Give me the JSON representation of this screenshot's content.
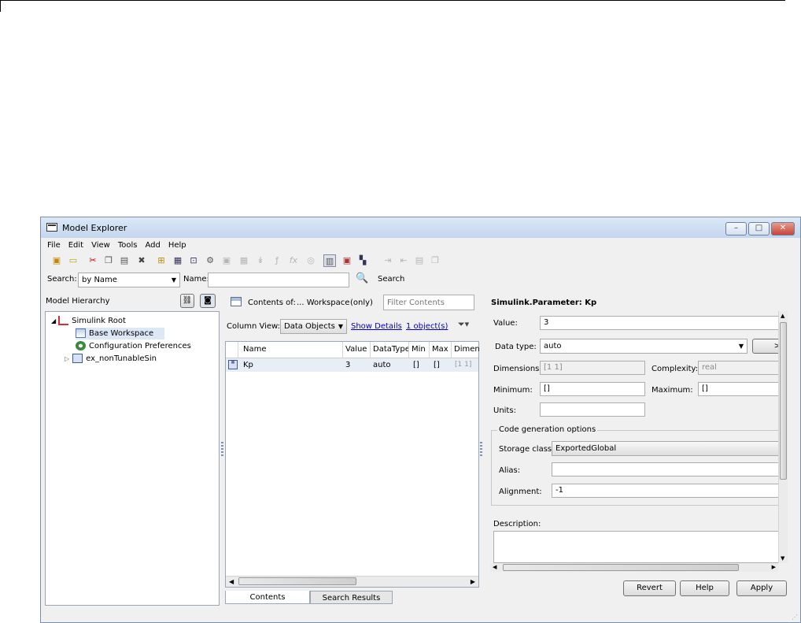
{
  "window": {
    "title": "Model Explorer",
    "controls": {
      "minimize": "–",
      "maximize": "□",
      "close": "✕"
    }
  },
  "menu": [
    "File",
    "Edit",
    "View",
    "Tools",
    "Add",
    "Help"
  ],
  "toolbar_icons": [
    "new-model-icon",
    "open-folder-icon",
    "cut-icon",
    "copy-icon",
    "paste-icon",
    "delete-icon",
    "add-variable-icon",
    "add-parameter-icon",
    "add-signal-icon",
    "add-config-icon",
    "add-bus-icon",
    "add-data-icon",
    "add-port-icon",
    "add-event-icon",
    "add-function-icon",
    "add-message-icon",
    "contents-view-icon",
    "dialog-view-icon",
    "hierarchy-view-icon",
    "export-icon",
    "import-icon",
    "save-icon",
    "clone-icon"
  ],
  "search": {
    "label": "Search:",
    "mode": "by Name",
    "name_label": "Name:",
    "name_value": "",
    "button": "Search"
  },
  "hierarchy": {
    "title": "Model Hierarchy",
    "items": [
      {
        "label": "Simulink Root",
        "expander": "◢"
      },
      {
        "label": "Base Workspace"
      },
      {
        "label": "Configuration Preferences"
      },
      {
        "label": "ex_nonTunableSin",
        "expander": "▷"
      }
    ]
  },
  "contents": {
    "prefix": "Contents of:",
    "scope": "... Workspace",
    "only": "(only)",
    "filter_placeholder": "Filter Contents",
    "column_view_label": "Column View:",
    "column_view": "Data Objects",
    "show_details": "Show Details",
    "object_count": "1 object(s)",
    "columns": [
      "Name",
      "Value",
      "DataType",
      "Min",
      "Max",
      "Dimen"
    ],
    "rows": [
      {
        "name": "Kp",
        "value": "3",
        "datatype": "auto",
        "min": "[]",
        "max": "[]",
        "dim": "[1 1]"
      }
    ],
    "tabs": [
      "Contents",
      "Search Results"
    ]
  },
  "dialog": {
    "title": "Simulink.Parameter: Kp",
    "value_label": "Value:",
    "value": "3",
    "datatype_label": "Data type:",
    "datatype": "auto",
    "dimensions_label": "Dimensions:",
    "dimensions": "[1 1]",
    "complexity_label": "Complexity:",
    "complexity": "real",
    "minimum_label": "Minimum:",
    "minimum": "[]",
    "maximum_label": "Maximum:",
    "maximum": "[]",
    "units_label": "Units:",
    "units": "",
    "codegen_title": "Code generation options",
    "storage_label": "Storage class:",
    "storage": "ExportedGlobal",
    "alias_label": "Alias:",
    "alias": "",
    "alignment_label": "Alignment:",
    "alignment": "-1",
    "description_label": "Description:",
    "description": "",
    "buttons": {
      "revert": "Revert",
      "help": "Help",
      "apply": "Apply"
    }
  }
}
